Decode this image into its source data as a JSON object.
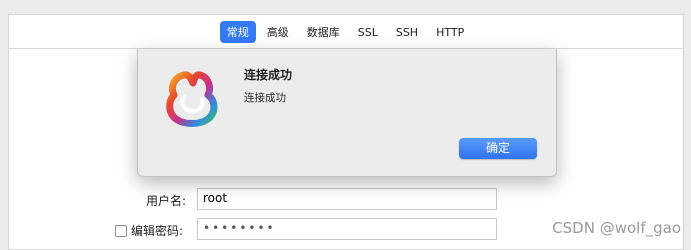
{
  "tabs": [
    {
      "label": "常规",
      "active": true
    },
    {
      "label": "高级",
      "active": false
    },
    {
      "label": "数据库",
      "active": false
    },
    {
      "label": "SSL",
      "active": false
    },
    {
      "label": "SSH",
      "active": false
    },
    {
      "label": "HTTP",
      "active": false
    }
  ],
  "dialog": {
    "title": "连接成功",
    "message": "连接成功",
    "ok_label": "确定",
    "logo_icon": "navicat-logo-icon"
  },
  "form": {
    "username_label": "用户名:",
    "username_value": "root",
    "edit_password_label": "编辑密码:",
    "password_value": "••••••••"
  },
  "watermark": "CSDN @wolf_gao",
  "colors": {
    "accent": "#3479f5",
    "dialog_bg": "#ececec"
  }
}
